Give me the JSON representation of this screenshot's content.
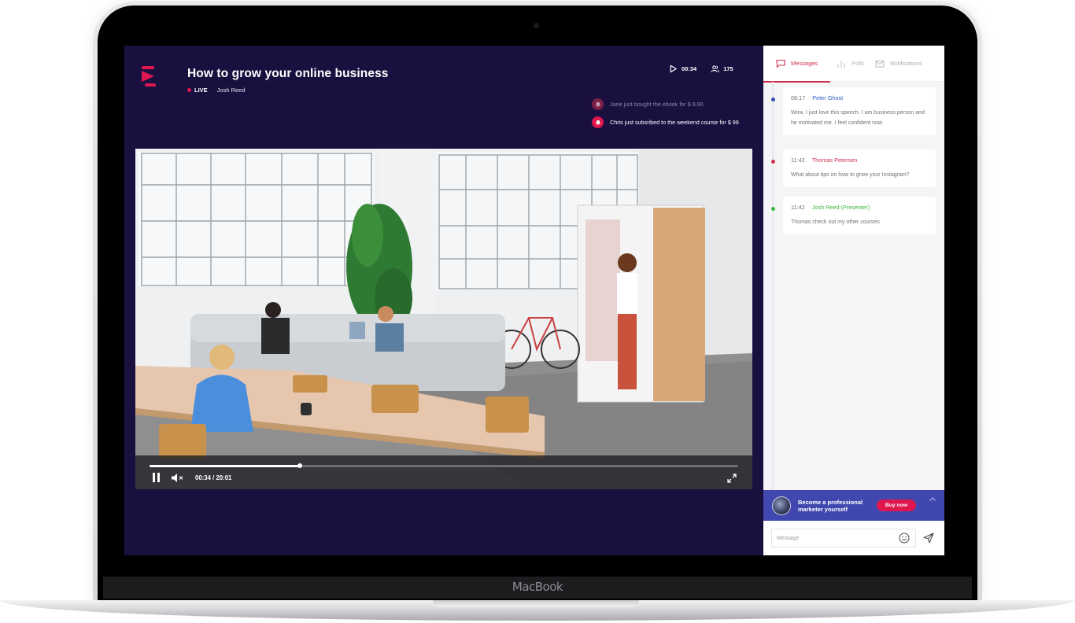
{
  "device": {
    "brand_label": "MacBook"
  },
  "stream": {
    "title": "How to grow your online business",
    "status": "LIVE",
    "presenter": "Josh Reed",
    "elapsed": "00:34",
    "viewers": "175"
  },
  "notifications": [
    {
      "text": "Jane just bought the ebook for $ 9.90",
      "icon": "bell-icon"
    },
    {
      "text": "Chris just subsribed to the weekend course for $ 99",
      "icon": "bell-icon"
    }
  ],
  "player": {
    "time_display": "00:34 / 20:01",
    "current": "00:34",
    "duration": "20:01",
    "progress_percent": 25.5,
    "state": "playing",
    "muted": true
  },
  "panel": {
    "tabs": [
      {
        "label": "Messages",
        "icon": "chat-bubble-icon",
        "active": true
      },
      {
        "label": "Polls",
        "icon": "bar-chart-icon",
        "active": false
      },
      {
        "label": "Notifications",
        "icon": "envelope-icon",
        "active": false
      }
    ],
    "messages": [
      {
        "time": "08:17",
        "author": "Peter Ghost",
        "color": "#2f5fc4",
        "text": "Wow. I just love this speech. I am business person and he motivated me. I feel confident now."
      },
      {
        "time": "11:42",
        "author": "Thomas Petersen",
        "color": "#d0304f",
        "text": "What about tips on how to grow your Instagram?"
      },
      {
        "time": "11:42",
        "author": "Josh Reed (Presenter)",
        "color": "#3fb53a",
        "text": "Thomas check out my other courses"
      }
    ],
    "promo": {
      "text": "Become a professional marketer yourself",
      "button": "Buy now"
    },
    "composer": {
      "placeholder": "Message",
      "value": ""
    }
  },
  "colors": {
    "stage_bg": "#1a1040",
    "accent": "#e0174f",
    "promo_bg": "#4048b0",
    "active_tab": "#d0304f"
  }
}
